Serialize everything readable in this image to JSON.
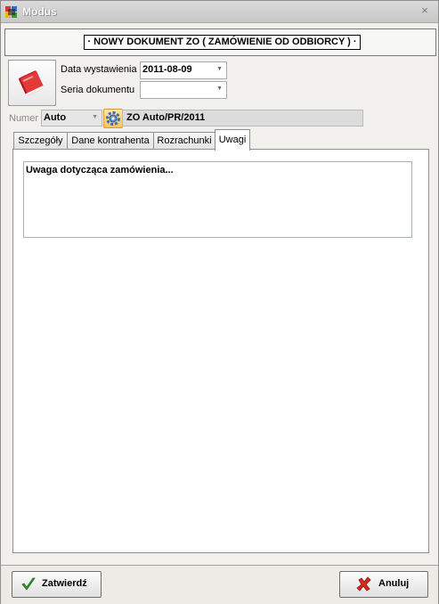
{
  "window": {
    "title": "Modus",
    "close_glyph": "×"
  },
  "header": {
    "document_title": "· NOWY DOKUMENT ZO ( ZAMÓWIENIE OD ODBIORCY ) ·"
  },
  "form": {
    "issue_date_label": "Data wystawienia",
    "issue_date_value": "2011-08-09",
    "series_label": "Seria dokumentu",
    "series_value": "",
    "number_label": "Numer",
    "number_mode_value": "Auto",
    "number_value": "ZO Auto/PR/2011"
  },
  "tabs": [
    {
      "label": "Szczegóły",
      "active": false
    },
    {
      "label": "Dane kontrahenta",
      "active": false
    },
    {
      "label": "Rozrachunki",
      "active": false
    },
    {
      "label": "Uwagi",
      "active": true
    }
  ],
  "notes": {
    "value": "Uwaga dotycząca zamówienia..."
  },
  "footer": {
    "confirm_label": "Zatwierdź",
    "cancel_label": "Anuluj"
  },
  "icons": {
    "app": "modus-app-icon",
    "document": "red-book-icon",
    "generate_number": "gear-icon",
    "confirm": "checkmark-icon",
    "cancel": "red-x-icon"
  },
  "colors": {
    "accent": "#f7c460",
    "cancel_red": "#d42a1e",
    "confirm_green": "#3a9a3a"
  }
}
